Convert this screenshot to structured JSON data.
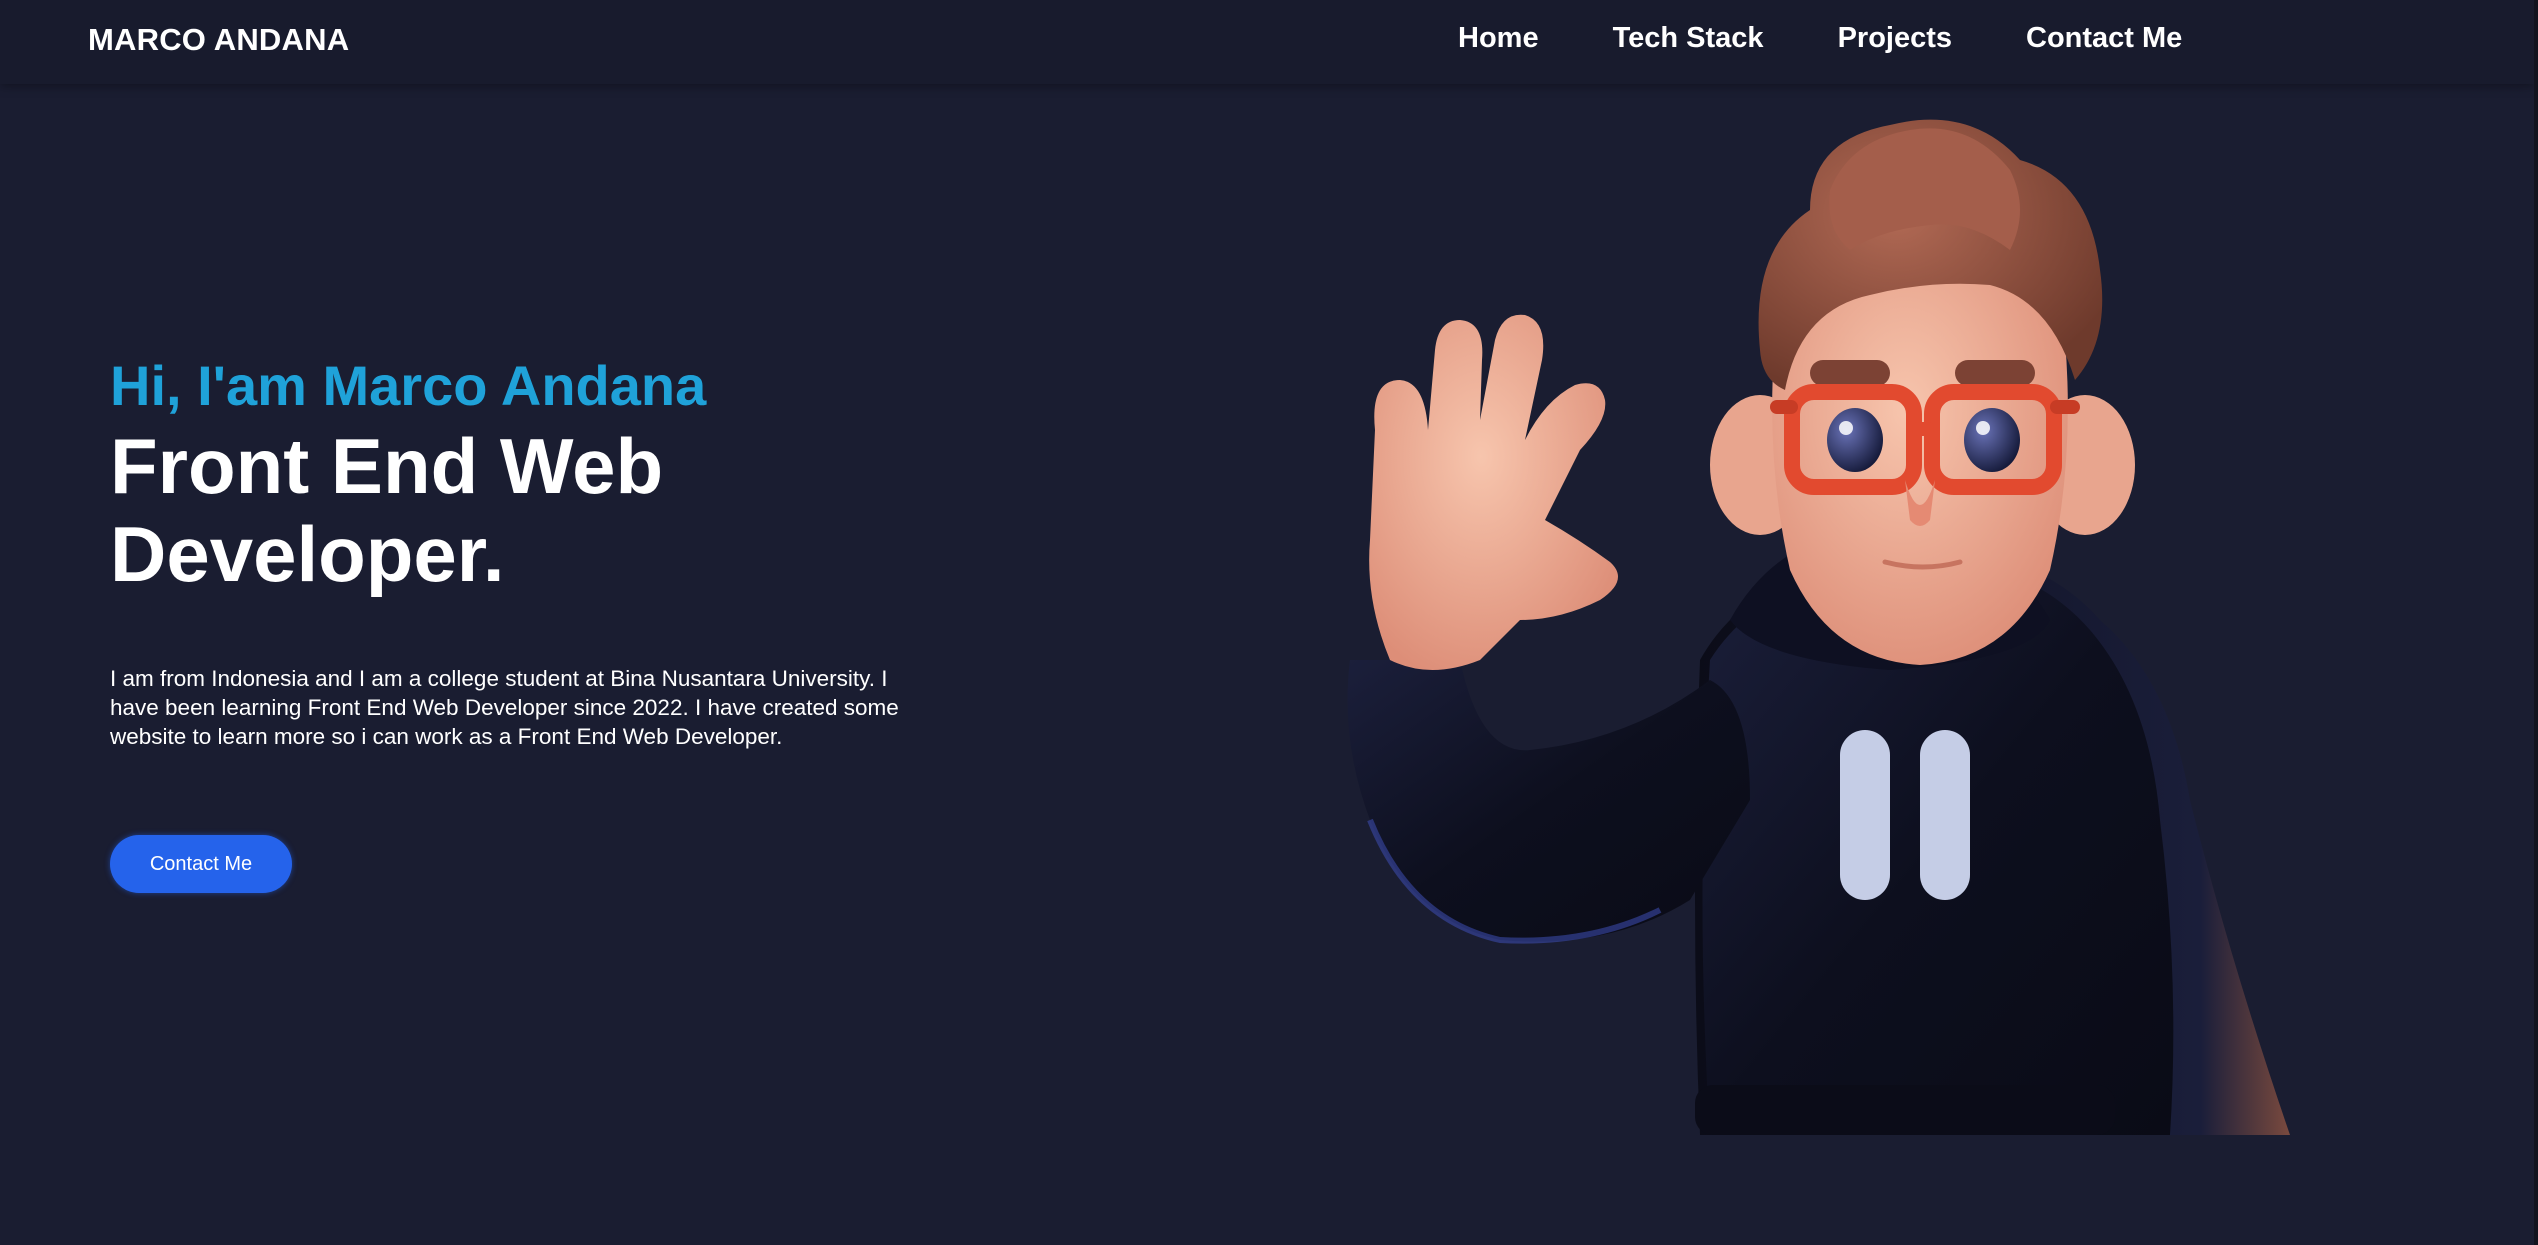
{
  "nav": {
    "brand": "MARCO ANDANA",
    "links": [
      "Home",
      "Tech Stack",
      "Projects",
      "Contact Me"
    ]
  },
  "hero": {
    "greeting": "Hi, I'am Marco Andana",
    "role": "Front End Web Developer.",
    "bio": "I am from Indonesia and I am a college student at Bina Nusantara University. I have been learning Front End Web Developer since 2022. I have created some website to learn more so i can work as a Front End Web Developer.",
    "cta_label": "Contact Me"
  },
  "icons": {
    "avatar": "waving-3d-character-illustration"
  },
  "colors": {
    "background": "#1a1d31",
    "navbar": "#181b2d",
    "accent": "#1fa2d9",
    "button": "#2563eb"
  }
}
